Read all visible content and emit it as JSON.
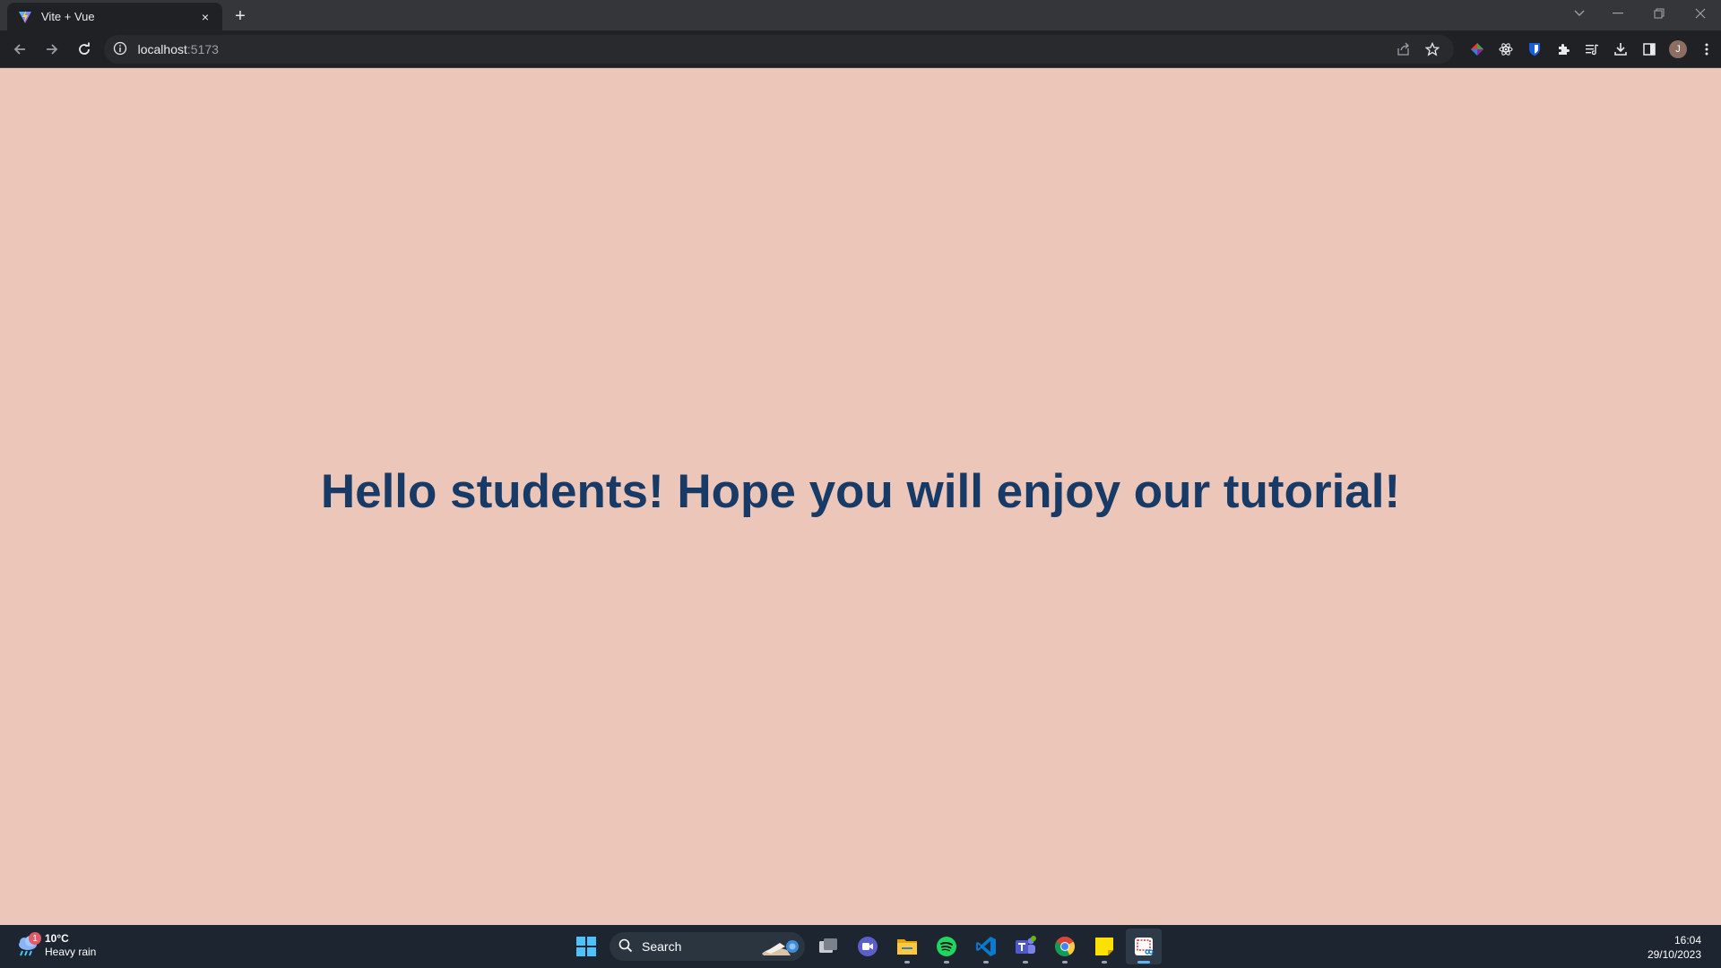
{
  "browser": {
    "tab": {
      "title": "Vite + Vue",
      "close_label": "×"
    },
    "new_tab_label": "+",
    "address": {
      "host": "localhost",
      "port": ":5173"
    },
    "profile_initial": "J"
  },
  "page": {
    "background": "#ecc6b9",
    "heading_color": "#173a66",
    "heading": "Hello students! Hope you will enjoy our tutorial!"
  },
  "taskbar": {
    "weather": {
      "temperature": "10°C",
      "condition": "Heavy rain",
      "badge_count": "1"
    },
    "search_label": "Search",
    "apps": [
      "start-icon",
      "task-view-icon",
      "meet-icon",
      "file-explorer-icon",
      "spotify-icon",
      "vscode-icon",
      "teams-icon",
      "chrome-icon",
      "sticky-notes-icon",
      "snipping-tool-icon"
    ],
    "clock": {
      "time": "16:04",
      "date": "29/10/2023"
    }
  }
}
